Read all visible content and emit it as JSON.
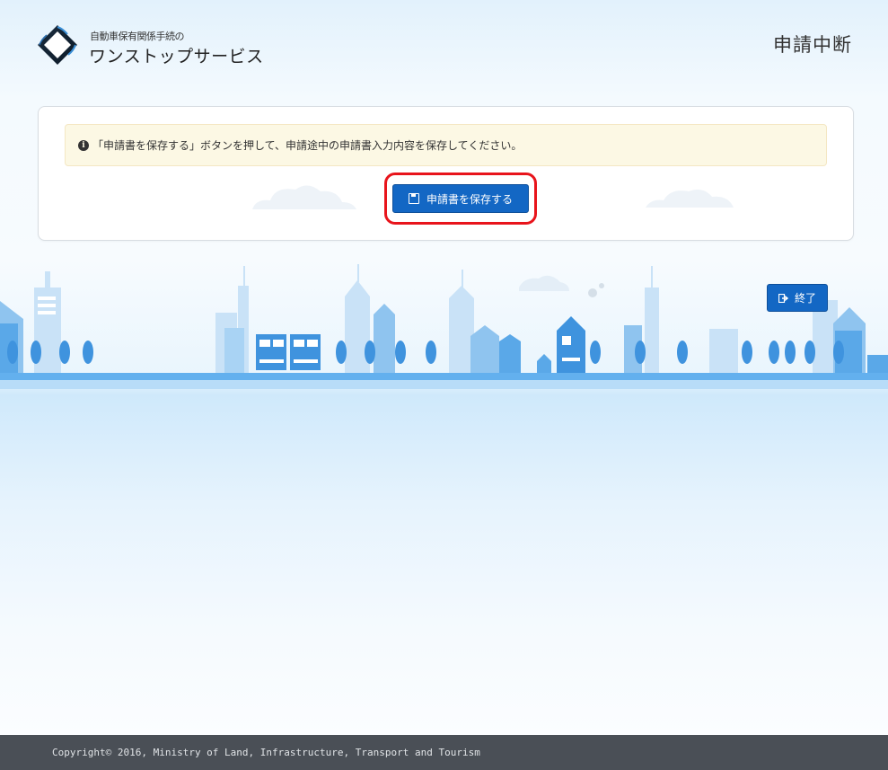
{
  "header": {
    "logo_small": "自動車保有関係手続の",
    "logo_big": "ワンストップサービス",
    "page_title": "申請中断"
  },
  "alert": {
    "icon": "info-circle-icon",
    "message": "「申請書を保存する」ボタンを押して、申請途中の申請書入力内容を保存してください。"
  },
  "save_button": {
    "icon": "save-icon",
    "label": "申請書を保存する"
  },
  "end_button": {
    "icon": "sign-out-icon",
    "label": "終了"
  },
  "footer": {
    "copyright": "Copyright© 2016, Ministry of Land, Infrastructure, Transport and Tourism"
  },
  "colors": {
    "primary_button": "#1367c4",
    "highlight": "#e8141b",
    "alert_bg": "#fcf8e4",
    "footer_bg": "#4a4f56",
    "city_ground": "#63b0ee"
  }
}
